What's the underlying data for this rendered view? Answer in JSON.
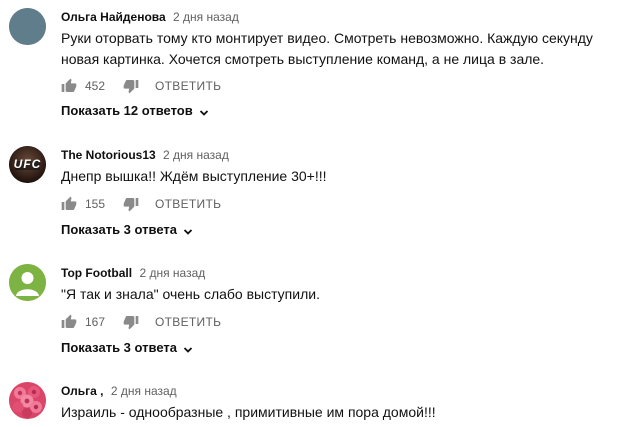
{
  "comments": [
    {
      "author": "Ольга Найденова",
      "time": "2 дня назад",
      "text": "Руки оторвать тому кто монтирует видео. Смотреть невозможно. Каждую секунду новая картинка. Хочется смотреть выступление команд, а не лица в зале.",
      "likes": "452",
      "reply_label": "ОТВЕТИТЬ",
      "replies_label": "Показать 12 ответов",
      "avatar_icon": "gray-circle-avatar",
      "avatar_color": "#607d8b"
    },
    {
      "author": "The Notorious13",
      "time": "2 дня назад",
      "text": "Днепр вышка!! Ждём выступление 30+!!!",
      "likes": "155",
      "reply_label": "ОТВЕТИТЬ",
      "replies_label": "Показать 3 ответа",
      "avatar_icon": "ufc-logo-avatar",
      "avatar_color": "#2b1a14"
    },
    {
      "author": "Top Football",
      "time": "2 дня назад",
      "text": "\"Я так и знала\" очень слабо выступили.",
      "likes": "167",
      "reply_label": "ОТВЕТИТЬ",
      "replies_label": "Показать 3 ответа",
      "avatar_icon": "person-avatar",
      "avatar_color": "#7cb342"
    },
    {
      "author": "Ольга ,",
      "time": "2 дня назад",
      "text": "Израиль - однообразные , примитивные им пора домой!!!",
      "avatar_icon": "roses-avatar",
      "avatar_color": "#e0607e"
    }
  ],
  "avatar_ufc_text": "UFC"
}
